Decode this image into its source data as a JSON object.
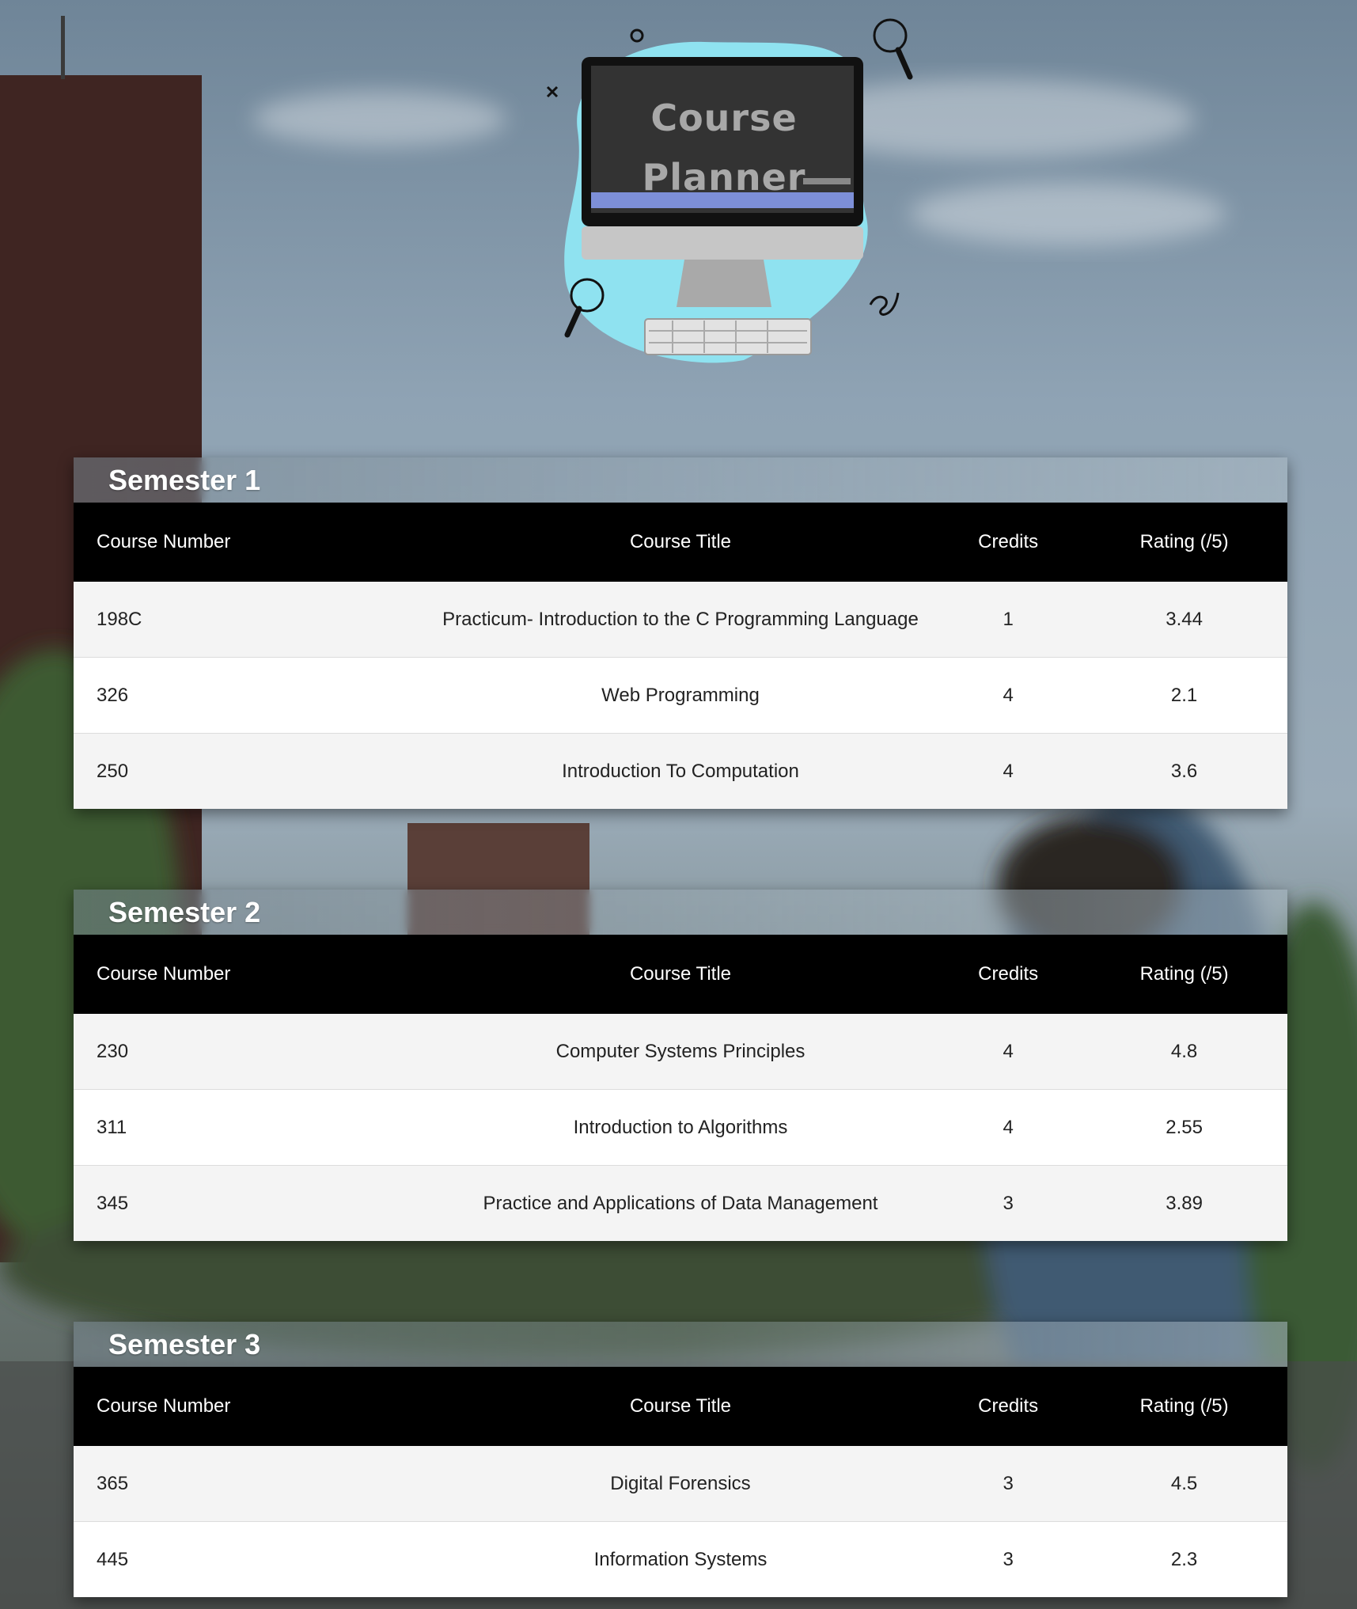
{
  "app": {
    "logo_line1": "Course",
    "logo_line2": "Planner"
  },
  "columns": {
    "number": "Course Number",
    "title": "Course Title",
    "credits": "Credits",
    "rating": "Rating (/5)"
  },
  "semesters": [
    {
      "title": "Semester 1",
      "courses": [
        {
          "number": "198C",
          "title": "Practicum- Introduction to the C Programming Language",
          "credits": "1",
          "rating": "3.44"
        },
        {
          "number": "326",
          "title": "Web Programming",
          "credits": "4",
          "rating": "2.1"
        },
        {
          "number": "250",
          "title": "Introduction To Computation",
          "credits": "4",
          "rating": "3.6"
        }
      ]
    },
    {
      "title": "Semester 2",
      "courses": [
        {
          "number": "230",
          "title": "Computer Systems Principles",
          "credits": "4",
          "rating": "4.8"
        },
        {
          "number": "311",
          "title": "Introduction to Algorithms",
          "credits": "4",
          "rating": "2.55"
        },
        {
          "number": "345",
          "title": "Practice and Applications of Data Management",
          "credits": "3",
          "rating": "3.89"
        }
      ]
    },
    {
      "title": "Semester 3",
      "courses": [
        {
          "number": "365",
          "title": "Digital Forensics",
          "credits": "3",
          "rating": "4.5"
        },
        {
          "number": "445",
          "title": "Information Systems",
          "credits": "3",
          "rating": "2.3"
        }
      ]
    }
  ]
}
